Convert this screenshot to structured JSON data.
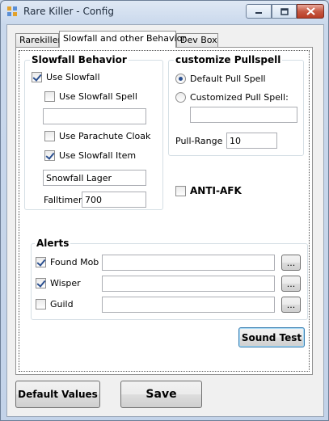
{
  "window": {
    "title": "Rare Killer - Config"
  },
  "tabs": [
    {
      "label": "Rarekiller"
    },
    {
      "label": "Slowfall and other Behavior"
    },
    {
      "label": "Dev Box"
    }
  ],
  "slowfall": {
    "title": "Slowfall Behavior",
    "use_slowfall": "Use Slowfall",
    "use_slowfall_spell": "Use Slowfall Spell",
    "slowfall_spell_value": "",
    "use_parachute": "Use Parachute Cloak",
    "use_slowfall_item": "Use Slowfall Item",
    "slowfall_item_value": "Snowfall Lager",
    "falltimer_label": "Falltimer:",
    "falltimer_value": "700"
  },
  "pullspell": {
    "title": "customize Pullspell",
    "default_pull": "Default Pull Spell",
    "custom_pull": "Customized Pull Spell:",
    "custom_value": "",
    "range_label": "Pull-Range",
    "range_value": "10"
  },
  "anti_afk": "ANTI-AFK",
  "alerts": {
    "title": "Alerts",
    "found_mob": "Found Mob",
    "found_mob_path": "",
    "wisper": "Wisper",
    "wisper_path": "",
    "guild": "Guild",
    "guild_path": "",
    "browse_label": "..."
  },
  "buttons": {
    "sound_test": "Sound Test",
    "default_values": "Default Values",
    "save": "Save"
  }
}
